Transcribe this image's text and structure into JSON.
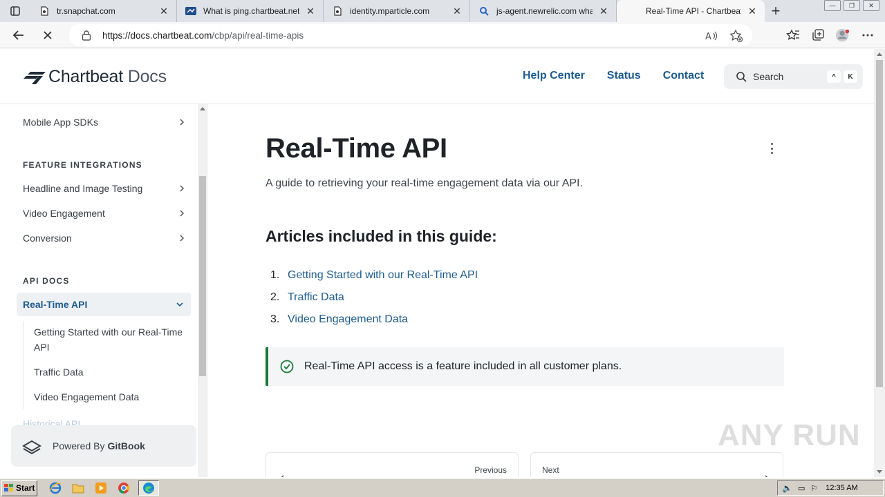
{
  "browser": {
    "tabs": [
      {
        "title": "tr.snapchat.com",
        "icon": "document-icon"
      },
      {
        "title": "What is ping.chartbeat.net?",
        "icon": "blue-flag-icon"
      },
      {
        "title": "identity.mparticle.com",
        "icon": "document-icon"
      },
      {
        "title": "js-agent.newrelic.com what",
        "icon": "search-icon"
      },
      {
        "title": "Real-Time API - Chartbeat D",
        "icon": "chartbeat-icon"
      }
    ],
    "url_host": "https://docs.chartbeat.com",
    "url_path": "/cbp/api/real-time-apis"
  },
  "header": {
    "logo_brand": "Chartbeat",
    "logo_suffix": "Docs",
    "links": [
      "Help Center",
      "Status",
      "Contact"
    ],
    "search_placeholder": "Search",
    "search_key_1": "^",
    "search_key_2": "K"
  },
  "sidebar": {
    "top_item": "Mobile App SDKs",
    "section_feature": "FEATURE INTEGRATIONS",
    "feature_items": [
      "Headline and Image Testing",
      "Video Engagement",
      "Conversion"
    ],
    "section_api": "API DOCS",
    "active_item": "Real-Time API",
    "sub_items": [
      "Getting Started with our Real-Time API",
      "Traffic Data",
      "Video Engagement Data"
    ],
    "faded_item": "Historical API",
    "powered_by": "Powered By",
    "powered_brand": "GitBook"
  },
  "main": {
    "title": "Real-Time API",
    "description": "A guide to retrieving your real-time engagement data via our API.",
    "articles_heading": "Articles included in this guide:",
    "articles": [
      {
        "num": "1.",
        "label": "Getting Started with our Real-Time API"
      },
      {
        "num": "2.",
        "label": "Traffic Data"
      },
      {
        "num": "3.",
        "label": "Video Engagement Data"
      }
    ],
    "hint": "Real-Time API access is a feature included in all customer plans.",
    "pager_previous": "Previous",
    "pager_next": "Next"
  },
  "watermark": "ANY RUN",
  "taskbar": {
    "start_label": "Start",
    "clock": "12:35 AM"
  },
  "colors": {
    "link": "#1c5b8f",
    "hint_border": "#1a7a3a"
  }
}
